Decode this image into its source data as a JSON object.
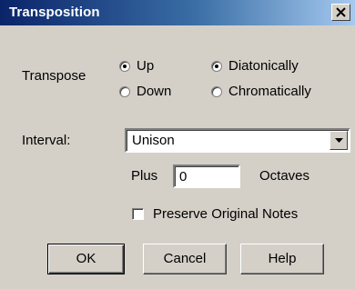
{
  "window": {
    "title": "Transposition"
  },
  "transpose": {
    "label": "Transpose",
    "direction_options": [
      {
        "label": "Up",
        "checked": true
      },
      {
        "label": "Down",
        "checked": false
      }
    ],
    "mode_options": [
      {
        "label": "Diatonically",
        "checked": true
      },
      {
        "label": "Chromatically",
        "checked": false
      }
    ]
  },
  "interval": {
    "label": "Interval:",
    "selected_value": "Unison"
  },
  "octaves": {
    "prefix_label": "Plus",
    "value": "0",
    "suffix_label": "Octaves"
  },
  "preserve": {
    "label": "Preserve Original Notes",
    "checked": false
  },
  "buttons": {
    "ok": "OK",
    "cancel": "Cancel",
    "help": "Help"
  }
}
